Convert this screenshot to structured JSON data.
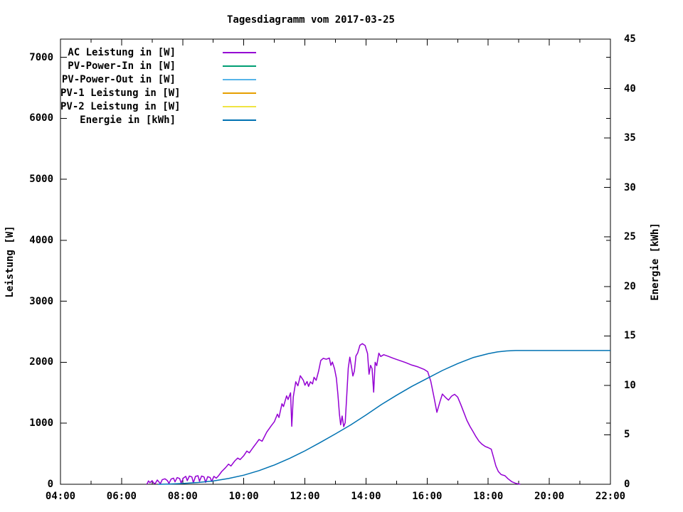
{
  "title": "Tagesdiagramm vom 2017-03-25",
  "legend": {
    "entries": [
      {
        "label": "AC Leistung in [W]",
        "color": "#9400d3"
      },
      {
        "label": "PV-Power-In in [W]",
        "color": "#009e73"
      },
      {
        "label": "PV-Power-Out in [W]",
        "color": "#56b4e9"
      },
      {
        "label": "PV-1 Leistung in [W]",
        "color": "#e69f00"
      },
      {
        "label": "PV-2 Leistung in [W]",
        "color": "#f0e442"
      },
      {
        "label": "Energie in [kWh]",
        "color": "#0072b2"
      }
    ]
  },
  "chart_data": {
    "type": "line",
    "title": "Tagesdiagramm vom 2017-03-25",
    "xlabel": "",
    "x_unit": "time_of_day_hours",
    "x_range": [
      4,
      22
    ],
    "x_major_tick_hours": 2,
    "x_minor_tick_hours": 1,
    "x_tick_labels": [
      "04:00",
      "06:00",
      "08:00",
      "10:00",
      "12:00",
      "14:00",
      "16:00",
      "18:00",
      "20:00",
      "22:00"
    ],
    "grid": false,
    "legend_position": "inside-top-left",
    "y1": {
      "label": "Leistung [W]",
      "range": [
        0,
        7300
      ],
      "ticks": [
        0,
        1000,
        2000,
        3000,
        4000,
        5000,
        6000,
        7000
      ]
    },
    "y2": {
      "label": "Energie [kWh]",
      "range": [
        0,
        45
      ],
      "ticks": [
        0,
        5,
        10,
        15,
        20,
        25,
        30,
        35,
        40,
        45
      ]
    },
    "series": [
      {
        "name": "AC Leistung in [W]",
        "color": "#9400d3",
        "axis": "y1",
        "points": [
          [
            6.83,
            0
          ],
          [
            6.88,
            55
          ],
          [
            6.93,
            25
          ],
          [
            7.0,
            60
          ],
          [
            7.05,
            20
          ],
          [
            7.1,
            10
          ],
          [
            7.17,
            70
          ],
          [
            7.22,
            40
          ],
          [
            7.27,
            8
          ],
          [
            7.33,
            75
          ],
          [
            7.42,
            90
          ],
          [
            7.5,
            60
          ],
          [
            7.55,
            15
          ],
          [
            7.62,
            85
          ],
          [
            7.7,
            100
          ],
          [
            7.75,
            40
          ],
          [
            7.82,
            110
          ],
          [
            7.9,
            95
          ],
          [
            7.95,
            20
          ],
          [
            8.02,
            100
          ],
          [
            8.1,
            130
          ],
          [
            8.15,
            60
          ],
          [
            8.22,
            135
          ],
          [
            8.3,
            120
          ],
          [
            8.35,
            25
          ],
          [
            8.42,
            130
          ],
          [
            8.5,
            140
          ],
          [
            8.55,
            50
          ],
          [
            8.62,
            135
          ],
          [
            8.7,
            120
          ],
          [
            8.75,
            30
          ],
          [
            8.82,
            125
          ],
          [
            8.9,
            110
          ],
          [
            8.95,
            45
          ],
          [
            9.02,
            130
          ],
          [
            9.1,
            100
          ],
          [
            9.18,
            145
          ],
          [
            9.28,
            210
          ],
          [
            9.4,
            270
          ],
          [
            9.5,
            330
          ],
          [
            9.58,
            300
          ],
          [
            9.7,
            380
          ],
          [
            9.8,
            430
          ],
          [
            9.88,
            405
          ],
          [
            10.0,
            470
          ],
          [
            10.1,
            545
          ],
          [
            10.18,
            515
          ],
          [
            10.3,
            600
          ],
          [
            10.42,
            680
          ],
          [
            10.5,
            735
          ],
          [
            10.6,
            705
          ],
          [
            10.75,
            855
          ],
          [
            10.9,
            960
          ],
          [
            11.0,
            1025
          ],
          [
            11.1,
            1150
          ],
          [
            11.15,
            1095
          ],
          [
            11.25,
            1320
          ],
          [
            11.3,
            1275
          ],
          [
            11.4,
            1450
          ],
          [
            11.45,
            1390
          ],
          [
            11.53,
            1500
          ],
          [
            11.57,
            950
          ],
          [
            11.62,
            1430
          ],
          [
            11.7,
            1680
          ],
          [
            11.77,
            1615
          ],
          [
            11.85,
            1780
          ],
          [
            11.95,
            1705
          ],
          [
            12.0,
            1625
          ],
          [
            12.07,
            1685
          ],
          [
            12.12,
            1605
          ],
          [
            12.18,
            1680
          ],
          [
            12.25,
            1645
          ],
          [
            12.3,
            1755
          ],
          [
            12.37,
            1705
          ],
          [
            12.45,
            1860
          ],
          [
            12.52,
            2030
          ],
          [
            12.6,
            2065
          ],
          [
            12.7,
            2050
          ],
          [
            12.8,
            2070
          ],
          [
            12.85,
            1950
          ],
          [
            12.9,
            2005
          ],
          [
            12.97,
            1895
          ],
          [
            13.03,
            1740
          ],
          [
            13.08,
            1480
          ],
          [
            13.13,
            1150
          ],
          [
            13.17,
            975
          ],
          [
            13.22,
            1120
          ],
          [
            13.27,
            945
          ],
          [
            13.32,
            1010
          ],
          [
            13.37,
            1460
          ],
          [
            13.42,
            1905
          ],
          [
            13.47,
            2085
          ],
          [
            13.52,
            1945
          ],
          [
            13.57,
            1775
          ],
          [
            13.62,
            1855
          ],
          [
            13.67,
            2105
          ],
          [
            13.73,
            2155
          ],
          [
            13.8,
            2280
          ],
          [
            13.88,
            2305
          ],
          [
            13.97,
            2275
          ],
          [
            14.05,
            2145
          ],
          [
            14.1,
            1805
          ],
          [
            14.15,
            1950
          ],
          [
            14.2,
            1895
          ],
          [
            14.25,
            1510
          ],
          [
            14.3,
            2000
          ],
          [
            14.35,
            1945
          ],
          [
            14.42,
            2150
          ],
          [
            14.48,
            2095
          ],
          [
            14.58,
            2125
          ],
          [
            14.72,
            2100
          ],
          [
            14.9,
            2065
          ],
          [
            15.1,
            2030
          ],
          [
            15.3,
            1995
          ],
          [
            15.5,
            1955
          ],
          [
            15.7,
            1925
          ],
          [
            15.9,
            1885
          ],
          [
            16.02,
            1845
          ],
          [
            16.12,
            1690
          ],
          [
            16.22,
            1440
          ],
          [
            16.32,
            1180
          ],
          [
            16.42,
            1355
          ],
          [
            16.5,
            1480
          ],
          [
            16.6,
            1425
          ],
          [
            16.7,
            1380
          ],
          [
            16.8,
            1445
          ],
          [
            16.9,
            1475
          ],
          [
            17.0,
            1430
          ],
          [
            17.1,
            1310
          ],
          [
            17.2,
            1180
          ],
          [
            17.3,
            1050
          ],
          [
            17.4,
            950
          ],
          [
            17.5,
            865
          ],
          [
            17.6,
            780
          ],
          [
            17.7,
            705
          ],
          [
            17.8,
            655
          ],
          [
            17.9,
            620
          ],
          [
            18.0,
            600
          ],
          [
            18.1,
            575
          ],
          [
            18.17,
            450
          ],
          [
            18.25,
            300
          ],
          [
            18.33,
            210
          ],
          [
            18.42,
            160
          ],
          [
            18.55,
            140
          ],
          [
            18.65,
            90
          ],
          [
            18.78,
            40
          ],
          [
            18.9,
            15
          ],
          [
            19.05,
            0
          ]
        ]
      },
      {
        "name": "PV-Power-In in [W]",
        "color": "#009e73",
        "axis": "y1",
        "points": []
      },
      {
        "name": "PV-Power-Out in [W]",
        "color": "#56b4e9",
        "axis": "y1",
        "points": []
      },
      {
        "name": "PV-1 Leistung in [W]",
        "color": "#e69f00",
        "axis": "y1",
        "points": []
      },
      {
        "name": "PV-2 Leistung in [W]",
        "color": "#f0e442",
        "axis": "y1",
        "points": []
      },
      {
        "name": "Energie in [kWh]",
        "color": "#0072b2",
        "axis": "y2",
        "points": [
          [
            7.2,
            0
          ],
          [
            7.6,
            0.03
          ],
          [
            8.0,
            0.08
          ],
          [
            8.5,
            0.18
          ],
          [
            9.0,
            0.33
          ],
          [
            9.5,
            0.58
          ],
          [
            10.0,
            0.92
          ],
          [
            10.5,
            1.38
          ],
          [
            11.0,
            1.95
          ],
          [
            11.5,
            2.62
          ],
          [
            12.0,
            3.38
          ],
          [
            12.5,
            4.22
          ],
          [
            13.0,
            5.1
          ],
          [
            13.5,
            6.0
          ],
          [
            14.0,
            7.0
          ],
          [
            14.5,
            8.05
          ],
          [
            15.0,
            9.0
          ],
          [
            15.5,
            9.9
          ],
          [
            16.0,
            10.7
          ],
          [
            16.5,
            11.5
          ],
          [
            17.0,
            12.2
          ],
          [
            17.5,
            12.8
          ],
          [
            18.0,
            13.2
          ],
          [
            18.3,
            13.38
          ],
          [
            18.6,
            13.48
          ],
          [
            18.9,
            13.52
          ],
          [
            22.0,
            13.52
          ]
        ]
      }
    ]
  }
}
